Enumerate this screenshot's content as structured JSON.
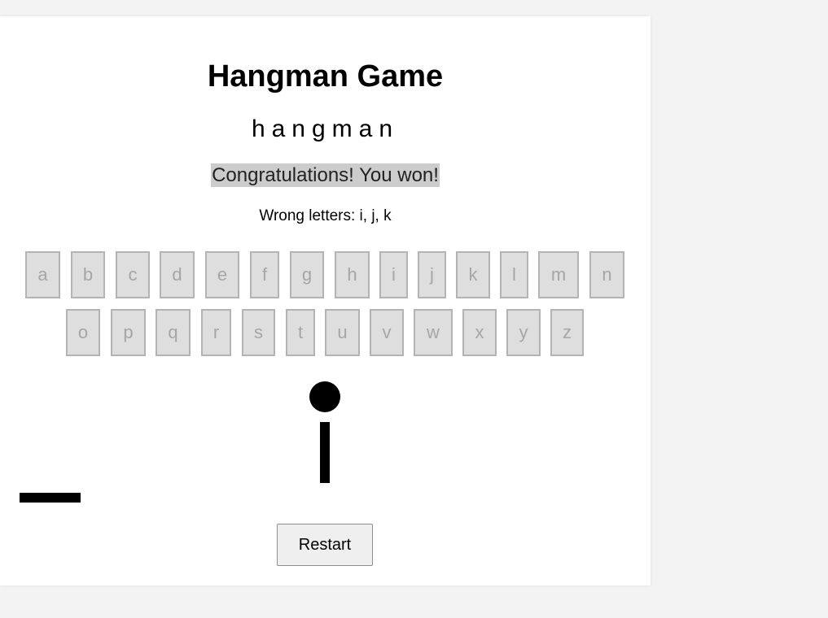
{
  "game": {
    "title": "Hangman Game",
    "word_display": "hangman",
    "status_message": "Congratulations! You won!",
    "wrong_letters_label": "Wrong letters: i, j, k",
    "wrong_letters": [
      "i",
      "j",
      "k"
    ],
    "restart_label": "Restart",
    "keyboard": {
      "row1": [
        "a",
        "b",
        "c",
        "d",
        "e",
        "f",
        "g",
        "h",
        "i",
        "j",
        "k",
        "l",
        "m",
        "n"
      ],
      "row2": [
        "o",
        "p",
        "q",
        "r",
        "s",
        "t",
        "u",
        "v",
        "w",
        "x",
        "y",
        "z"
      ],
      "all_disabled": true
    },
    "hangman_parts_shown": [
      "base",
      "head",
      "body"
    ],
    "colors": {
      "background": "#f3f3f3",
      "card": "#ffffff",
      "message_highlight": "#cccccc",
      "key_fill": "#dedede",
      "key_text_disabled": "#a6a6a6",
      "drawing": "#000000"
    }
  }
}
